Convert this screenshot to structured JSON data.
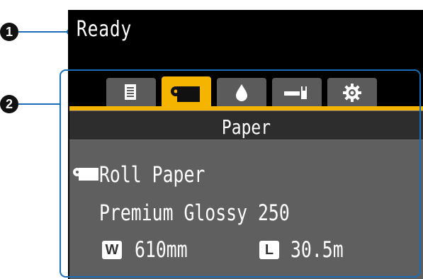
{
  "callouts": {
    "status": "1",
    "menu": "2"
  },
  "status": {
    "text": "Ready"
  },
  "tabs": [
    {
      "icon": "document-list-icon",
      "active": false
    },
    {
      "icon": "roll-paper-icon",
      "active": true
    },
    {
      "icon": "ink-drop-icon",
      "active": false
    },
    {
      "icon": "wrench-icon",
      "active": false
    },
    {
      "icon": "gear-icon",
      "active": false
    }
  ],
  "panel": {
    "title": "Paper",
    "source": "Roll Paper",
    "media_type": "Premium Glossy 250",
    "width_badge": "W",
    "width_value": "610mm",
    "length_badge": "L",
    "length_value": "30.5m"
  },
  "colors": {
    "accent": "#f5b400",
    "callout_line": "#1a6db5",
    "tab_inactive": "#5b5b5b",
    "panel_body": "#5f5f5f"
  }
}
